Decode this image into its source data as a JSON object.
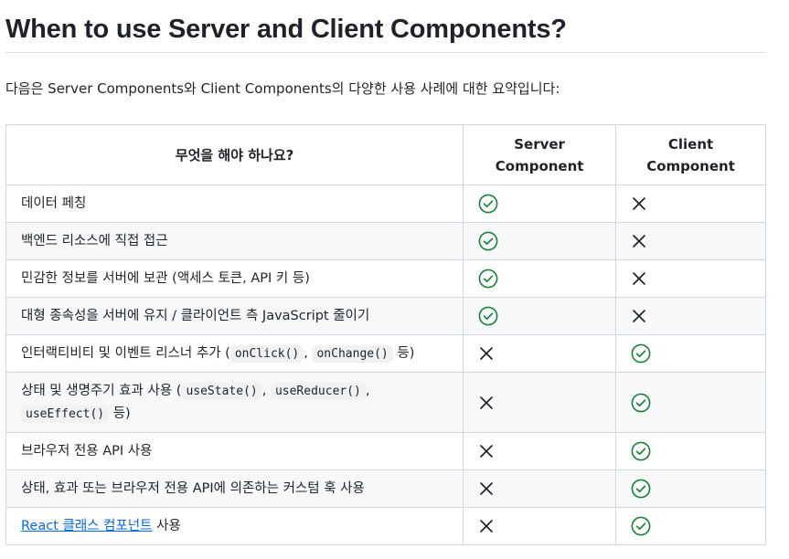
{
  "title": "When to use Server and Client Components?",
  "intro": "다음은 Server Components와 Client Components의 다양한 사용 사례에 대한 요약입니다:",
  "table": {
    "headers": [
      "무엇을 해야 하나요?",
      "Server Component",
      "Client Component"
    ],
    "rows": [
      {
        "text": "데이터 페칭"
      },
      {
        "text": "백엔드 리소스에 직접 접근"
      },
      {
        "text": "민감한 정보를 서버에 보관 (액세스 토큰, API 키 등)"
      },
      {
        "text": "대형 종속성을 서버에 유지 / 클라이언트 측 JavaScript 줄이기"
      },
      {
        "text_before": "인터랙티비티 및 이벤트 리스너 추가 (",
        "code1": "onClick()",
        "sep": ",",
        "code2": "onChange()",
        "text_after": "등)"
      },
      {
        "text_before": "상태 및 생명주기 효과 사용 (",
        "code1": "useState()",
        "sep1": ",",
        "code2": "useReducer()",
        "sep2": ",",
        "code3": "useEffect()",
        "text_after": "등)"
      },
      {
        "text": "브라우저 전용 API 사용"
      },
      {
        "text": "상태, 효과 또는 브라우저 전용 API에 의존하는 커스텀 훅 사용"
      },
      {
        "link": "React 클래스 컴포넌트",
        "text_after": "사용"
      }
    ]
  },
  "colors": {
    "check": "#1a7f37",
    "cross": "#1f2328",
    "link": "#0969da",
    "border": "#d0d7de",
    "alt_row": "#f6f8fa"
  }
}
